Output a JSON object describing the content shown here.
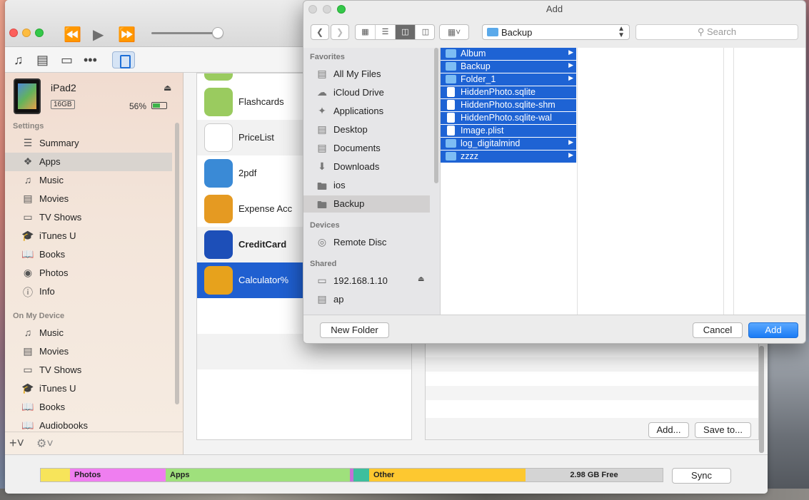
{
  "itunes": {
    "device": {
      "name": "iPad2",
      "capacity": "16GB",
      "battery_pct": "56%"
    },
    "sidebar": {
      "settings_heading": "Settings",
      "settings_items": [
        {
          "label": "Summary",
          "icon": "summary-icon"
        },
        {
          "label": "Apps",
          "icon": "apps-icon"
        },
        {
          "label": "Music",
          "icon": "music-icon"
        },
        {
          "label": "Movies",
          "icon": "movies-icon"
        },
        {
          "label": "TV Shows",
          "icon": "tv-icon"
        },
        {
          "label": "iTunes U",
          "icon": "itunes-u-icon"
        },
        {
          "label": "Books",
          "icon": "books-icon"
        },
        {
          "label": "Photos",
          "icon": "photos-icon"
        },
        {
          "label": "Info",
          "icon": "info-icon"
        }
      ],
      "device_heading": "On My Device",
      "device_items": [
        {
          "label": "Music"
        },
        {
          "label": "Movies"
        },
        {
          "label": "TV Shows"
        },
        {
          "label": "iTunes U"
        },
        {
          "label": "Books"
        },
        {
          "label": "Audiobooks"
        }
      ]
    },
    "apps": [
      {
        "name": "Flashcards",
        "color": "#9acb5f"
      },
      {
        "name": "PriceList",
        "color": "#ffffff"
      },
      {
        "name": "2pdf",
        "color": "#3a8ad6"
      },
      {
        "name": "Expense Acc",
        "color": "#e59a22"
      },
      {
        "name": "CreditCard",
        "color": "#1d4fb8"
      },
      {
        "name": "Calculator%",
        "color": "#e7a21c"
      }
    ],
    "docs_buttons": {
      "add": "Add...",
      "save": "Save to..."
    },
    "capacity": {
      "photos": "Photos",
      "apps": "Apps",
      "other": "Other",
      "free": "2.98 GB Free",
      "sync": "Sync"
    }
  },
  "dialog": {
    "title": "Add",
    "path": "Backup",
    "search_placeholder": "Search",
    "favorites_heading": "Favorites",
    "favorites": [
      {
        "label": "All My Files",
        "icon": "all-files-icon"
      },
      {
        "label": "iCloud Drive",
        "icon": "cloud-icon"
      },
      {
        "label": "Applications",
        "icon": "applications-icon"
      },
      {
        "label": "Desktop",
        "icon": "desktop-icon"
      },
      {
        "label": "Documents",
        "icon": "documents-icon"
      },
      {
        "label": "Downloads",
        "icon": "downloads-icon"
      },
      {
        "label": "ios",
        "icon": "folder-icon"
      },
      {
        "label": "Backup",
        "icon": "folder-icon"
      }
    ],
    "devices_heading": "Devices",
    "devices": [
      {
        "label": "Remote Disc"
      }
    ],
    "shared_heading": "Shared",
    "shared": [
      {
        "label": "192.168.1.10"
      },
      {
        "label": "ap"
      }
    ],
    "files": [
      {
        "name": "Album",
        "type": "folder"
      },
      {
        "name": "Backup",
        "type": "folder"
      },
      {
        "name": "Folder_1",
        "type": "folder"
      },
      {
        "name": "HiddenPhoto.sqlite",
        "type": "file"
      },
      {
        "name": "HiddenPhoto.sqlite-shm",
        "type": "file"
      },
      {
        "name": "HiddenPhoto.sqlite-wal",
        "type": "file"
      },
      {
        "name": "Image.plist",
        "type": "file"
      },
      {
        "name": "log_digitalmind",
        "type": "folder"
      },
      {
        "name": "zzzz",
        "type": "folder"
      }
    ],
    "buttons": {
      "new_folder": "New Folder",
      "cancel": "Cancel",
      "add": "Add"
    }
  }
}
